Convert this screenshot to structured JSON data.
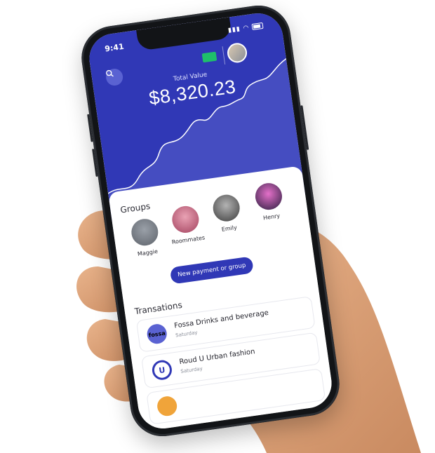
{
  "status": {
    "time": "9:41"
  },
  "hero": {
    "total_label": "Total Value",
    "total_value": "$8,320.23"
  },
  "groups": {
    "title": "Groups",
    "items": [
      {
        "name": "Maggie"
      },
      {
        "name": "Roommates"
      },
      {
        "name": "Emily"
      },
      {
        "name": "Henry"
      }
    ],
    "cta_label": "New payment or group"
  },
  "transactions": {
    "title": "Transations",
    "items": [
      {
        "title": "Fossa Drinks and beverage",
        "date": "Saturday",
        "logo_text": "fossa"
      },
      {
        "title": "Roud U Urban fashion",
        "date": "Saturday",
        "logo_text": "U"
      }
    ]
  },
  "colors": {
    "primary": "#3038b6",
    "card_green": "#1fbf6b",
    "text": "#2a2a33",
    "muted": "#8b8f9a"
  },
  "icons": [
    "search-icon",
    "card-icon",
    "wifi-icon",
    "battery-icon",
    "signal-icon"
  ]
}
